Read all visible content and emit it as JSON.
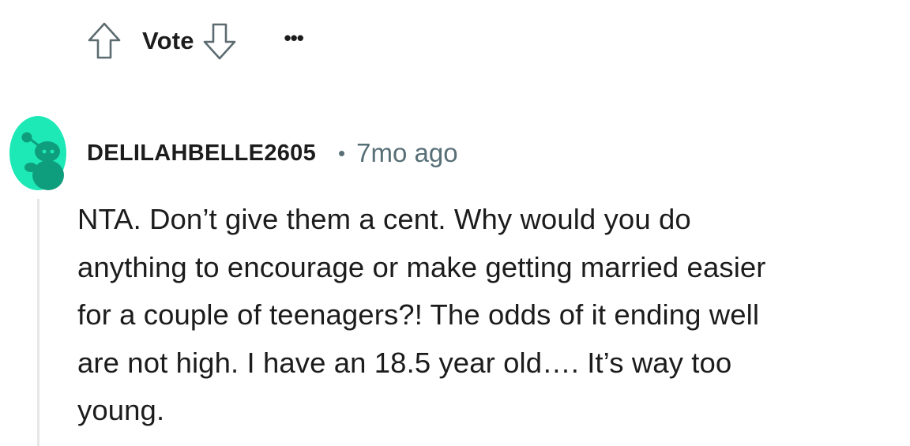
{
  "actions": {
    "vote_label": "Vote",
    "upvote_icon": "arrow-up-outline-icon",
    "downvote_icon": "arrow-down-outline-icon",
    "more_label": "•••"
  },
  "comment": {
    "avatar_icon": "snoo-avatar-icon",
    "avatar_color": "#1de9b6",
    "username": "DELILAHBELLE2605",
    "separator": "•",
    "timestamp": "7mo ago",
    "body_lines": [
      "NTA. Don’t give them a cent. Why would you do",
      "anything to encourage or make getting married easier",
      "for a couple of teenagers?! The odds of it ending well",
      "are not high. I have an 18.5 year old…. It’s way too",
      "young."
    ]
  },
  "colors": {
    "text_primary": "#1c1c1c",
    "text_meta": "#576f76",
    "thread_line": "#e6e6e6",
    "icon_stroke": "#5c6b70"
  }
}
